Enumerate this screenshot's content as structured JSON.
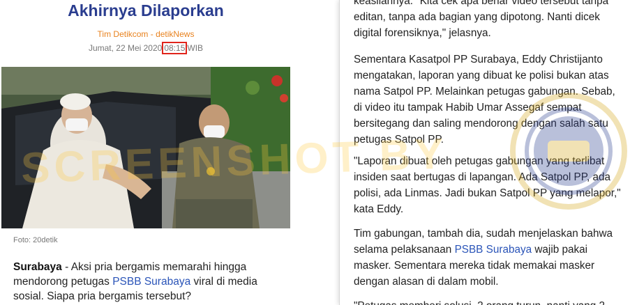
{
  "left": {
    "headline": "Akhirnya Dilaporkan",
    "byline": "Tim Detikcom - detikNews",
    "date_prefix": "Jumat, 22 Mei 2020",
    "time": "08:15",
    "timezone": "WIB",
    "photo_caption": "Foto: 20detik",
    "lede_location": "Surabaya",
    "lede_part1": " - Aksi pria bergamis memarahi hingga mendorong petugas ",
    "lede_link": "PSBB Surabaya",
    "lede_part2": " viral di media sosial. Siapa pria bergamis tersebut?"
  },
  "right": {
    "p1": "keasliannya. \"Kita cek apa benar video tersebut tanpa editan, tanpa ada bagian yang dipotong. Nanti dicek digital forensiknya,\" jelasnya.",
    "p2": "Sementara Kasatpol PP Surabaya, Eddy Christijanto mengatakan, laporan yang dibuat ke polisi bukan atas nama Satpol PP. Melainkan petugas gabungan. Sebab, di video itu tampak Habib Umar Assegaf sempat bersitegang dan saling mendorong dengan salah satu petugas Satpol PP.",
    "p3": "\"Laporan dibuat oleh petugas gabungan yang terlibat insiden saat bertugas di lapangan. Ada Satpol PP, ada polisi, ada Linmas. Jadi bukan Satpol PP yang melapor,\" kata Eddy.",
    "p4_part1": "Tim gabungan, tambah dia, sudah menjelaskan bahwa selama pelaksanaan ",
    "p4_link": "PSBB Surabaya",
    "p4_part2": " wajib pakai masker. Sementara mereka tidak memakai masker dengan alasan di dalam mobil.",
    "p5": "\"Petugas memberi solusi, 2 orang turun, nanti yang 2"
  },
  "watermark": "SCREENSHOT BY",
  "seal_text": "TURN BACK HOAX",
  "colors": {
    "headline": "#2a3d8f",
    "byline": "#e8821e",
    "link": "#2a54b8",
    "time_box": "#e0241b",
    "watermark": "#ffc83c"
  }
}
